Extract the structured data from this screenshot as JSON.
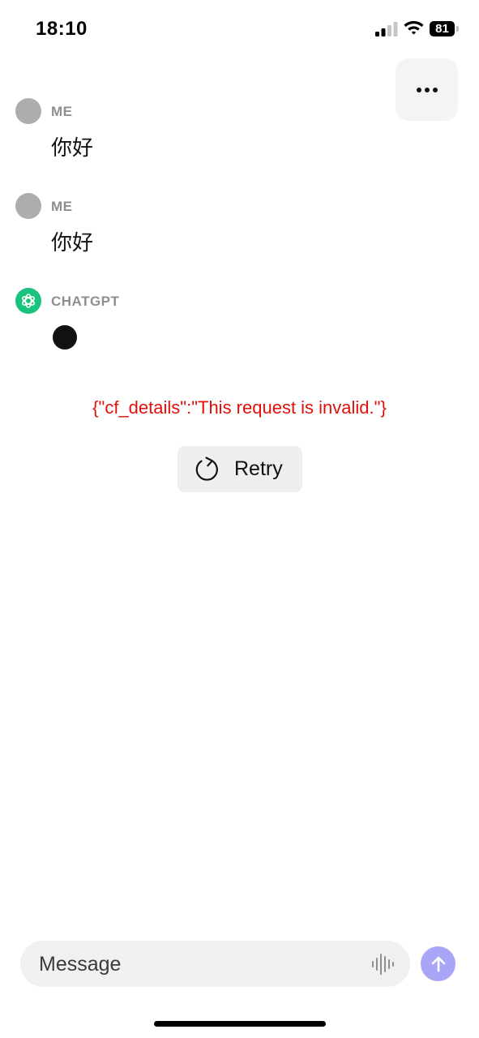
{
  "status_bar": {
    "time": "18:10",
    "battery": "81"
  },
  "messages": [
    {
      "sender": "ME",
      "text": "你好"
    },
    {
      "sender": "ME",
      "text": "你好"
    },
    {
      "sender": "CHATGPT",
      "text": ""
    }
  ],
  "error": {
    "text": "{\"cf_details\":\"This request is invalid.\"}",
    "color": "#e0100a"
  },
  "retry": {
    "label": "Retry"
  },
  "composer": {
    "placeholder": "Message"
  },
  "colors": {
    "gpt_avatar": "#19c37d",
    "send_button": "#a9a6f7",
    "user_avatar": "#adadad"
  },
  "icons": {
    "more": "more-horizontal-icon",
    "retry": "refresh-icon",
    "voice": "waveform-icon",
    "send": "arrow-up-icon"
  }
}
